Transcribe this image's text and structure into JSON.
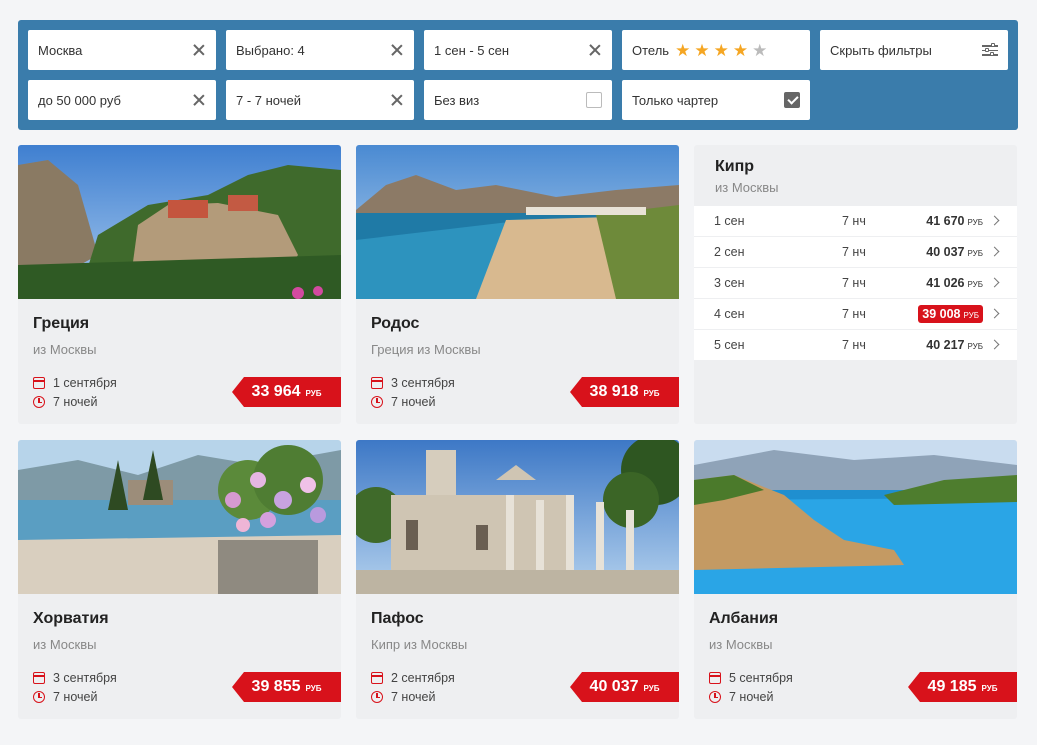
{
  "filters": {
    "origin": "Москва",
    "selected": "Выбрано: 4",
    "dates": "1 сен - 5 сен",
    "hotel_label": "Отель",
    "hotel_stars": 4,
    "hotel_stars_max": 5,
    "hide_filters": "Скрыть фильтры",
    "budget": "до 50 000 руб",
    "nights": "7 - 7 ночей",
    "no_visa": "Без виз",
    "no_visa_checked": false,
    "charter_only": "Только чартер",
    "charter_only_checked": true
  },
  "currency": "РУБ",
  "cards": [
    {
      "title": "Греция",
      "subtitle": "из Москвы",
      "date": "1 сентября",
      "nights": "7 ночей",
      "price": "33 964"
    },
    {
      "title": "Родос",
      "subtitle": "Греция из Москвы",
      "date": "3 сентября",
      "nights": "7 ночей",
      "price": "38 918"
    },
    {
      "title": "Хорватия",
      "subtitle": "из Москвы",
      "date": "3 сентября",
      "nights": "7 ночей",
      "price": "39 855"
    },
    {
      "title": "Пафос",
      "subtitle": "Кипр из Москвы",
      "date": "2 сентября",
      "nights": "7 ночей",
      "price": "40 037"
    },
    {
      "title": "Албания",
      "subtitle": "из Москвы",
      "date": "5 сентября",
      "nights": "7 ночей",
      "price": "49 185"
    }
  ],
  "kipr": {
    "title": "Кипр",
    "subtitle": "из Москвы",
    "rows": [
      {
        "date": "1 сен",
        "nights": "7 нч",
        "price": "41 670",
        "highlight": false
      },
      {
        "date": "2 сен",
        "nights": "7 нч",
        "price": "40 037",
        "highlight": false
      },
      {
        "date": "3 сен",
        "nights": "7 нч",
        "price": "41 026",
        "highlight": false
      },
      {
        "date": "4 сен",
        "nights": "7 нч",
        "price": "39 008",
        "highlight": true
      },
      {
        "date": "5 сен",
        "nights": "7 нч",
        "price": "40 217",
        "highlight": false
      }
    ]
  },
  "colors": {
    "panel": "#3a7cab",
    "accent": "#d8121b",
    "star": "#f5a623"
  }
}
